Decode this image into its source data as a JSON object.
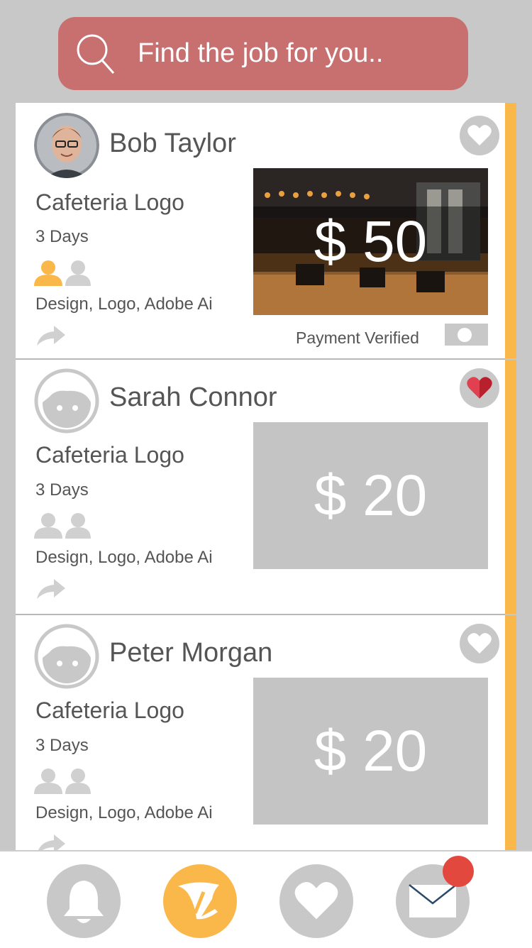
{
  "search": {
    "placeholder": "Find the job for you.."
  },
  "jobs": [
    {
      "name": "Bob Taylor",
      "title": "Cafeteria Logo",
      "duration": "3 Days",
      "tags": "Design, Logo, Adobe Ai",
      "price": "$ 50",
      "verified_label": "Payment Verified",
      "favorited": false,
      "avatar": "photo",
      "applicants_filled": 1
    },
    {
      "name": "Sarah Connor",
      "title": "Cafeteria Logo",
      "duration": "3 Days",
      "tags": "Design, Logo, Adobe Ai",
      "price": "$ 20",
      "favorited": true,
      "avatar": "placeholder",
      "applicants_filled": 0
    },
    {
      "name": "Peter Morgan",
      "title": "Cafeteria Logo",
      "duration": "3 Days",
      "tags": "Design, Logo, Adobe Ai",
      "price": "$ 20",
      "favorited": false,
      "avatar": "placeholder",
      "applicants_filled": 0
    }
  ],
  "nav": [
    {
      "icon": "bell-icon",
      "active": false
    },
    {
      "icon": "hat-icon",
      "active": true
    },
    {
      "icon": "heart-icon",
      "active": false
    },
    {
      "icon": "mail-icon",
      "active": false,
      "badge": true
    }
  ],
  "colors": {
    "accent": "#fbb84a",
    "search_bg": "#c87070",
    "heart_active": "#d7323f",
    "badge": "#e2483d",
    "gray": "#c8c8c8"
  }
}
